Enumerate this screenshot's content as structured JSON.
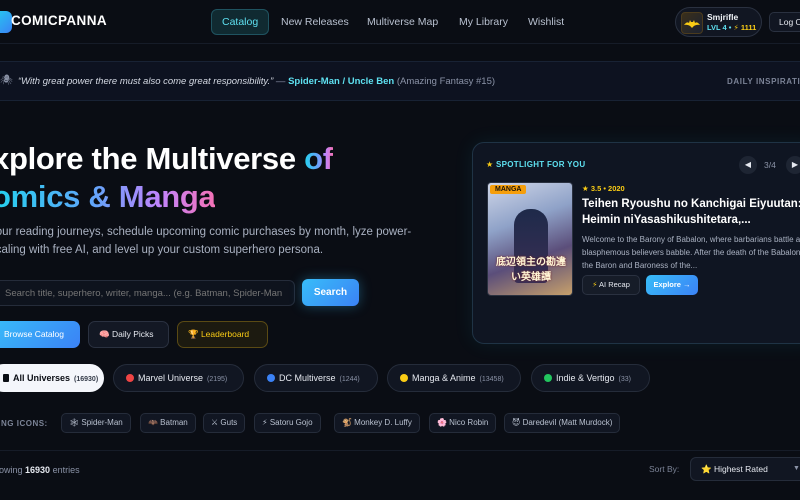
{
  "app": {
    "name": "COMICPANNA"
  },
  "nav": {
    "links": [
      "Catalog",
      "New Releases",
      "Multiverse Map",
      "My Library",
      "Wishlist"
    ],
    "active_index": 0
  },
  "user": {
    "name": "Smjrifle",
    "level": "LVL 4 •",
    "points": "⚡ 1111",
    "avatar_caption": "BATMAN"
  },
  "logout_label": "Log O",
  "quote": {
    "text": "“With great power there must also come great responsibility.”",
    "dash": " — ",
    "source": "Spider-Man / Uncle Ben",
    "ref": " (Amazing Fantasy #15)",
    "label": "DAILY INSPIRATION"
  },
  "hero": {
    "title_line1_a": "xplore the Multiverse ",
    "title_line1_b": "of",
    "title_line2": "omics & Manga",
    "desc": " your reading journeys, schedule upcoming comic purchases by month, lyze power-scaling with free AI, and level up your custom superhero persona.",
    "search_placeholder": "Search title, superhero, writer, manga... (e.g. Batman, Spider-Man",
    "search_button": "Search",
    "browse_button": "Browse Catalog",
    "picks_button": "Daily Picks",
    "leader_button": "Leaderboard"
  },
  "spotlight": {
    "label": "SPOTLIGHT FOR YOU",
    "counter": "3/4",
    "badge": "MANGA",
    "cover_text": "底辺領主の勘違い英雄譚",
    "meta": "3.5 • 2020",
    "title": "Teihen Ryoushu no Kanchigai Eiyuutan: Heimin niYasashikushitetara,...",
    "desc": "Welcome to the Barony of Babalon, where barbarians battle and blasphemous believers babble. After the death of the Babalons, the Baron and Baroness of the...",
    "recap_label": "AI Recap",
    "explore_label": "Explore →"
  },
  "universes": [
    {
      "label": "All Universes",
      "count": "(16930)",
      "color": "#0a0d14"
    },
    {
      "label": "Marvel Universe",
      "count": "(2195)",
      "color": "#ef4444"
    },
    {
      "label": "DC Multiverse",
      "count": "(1244)",
      "color": "#3b82f6"
    },
    {
      "label": "Manga & Anime",
      "count": "(13458)",
      "color": "#facc15"
    },
    {
      "label": "Indie & Vertigo",
      "count": "(33)",
      "color": "#22c55e"
    }
  ],
  "trending": {
    "label": "DING ICONS:",
    "chips": [
      "🕸 Spider-Man",
      "🦇 Batman",
      "⚔ Guts",
      "⚡ Satoru Gojo",
      "🐒 Monkey D. Luffy",
      "🌸 Nico Robin",
      "😈 Daredevil (Matt Murdock)"
    ]
  },
  "results": {
    "prefix": "howing ",
    "count": "16930",
    "suffix": " entries"
  },
  "sort": {
    "label": "Sort By:",
    "value": "⭐ Highest Rated"
  }
}
